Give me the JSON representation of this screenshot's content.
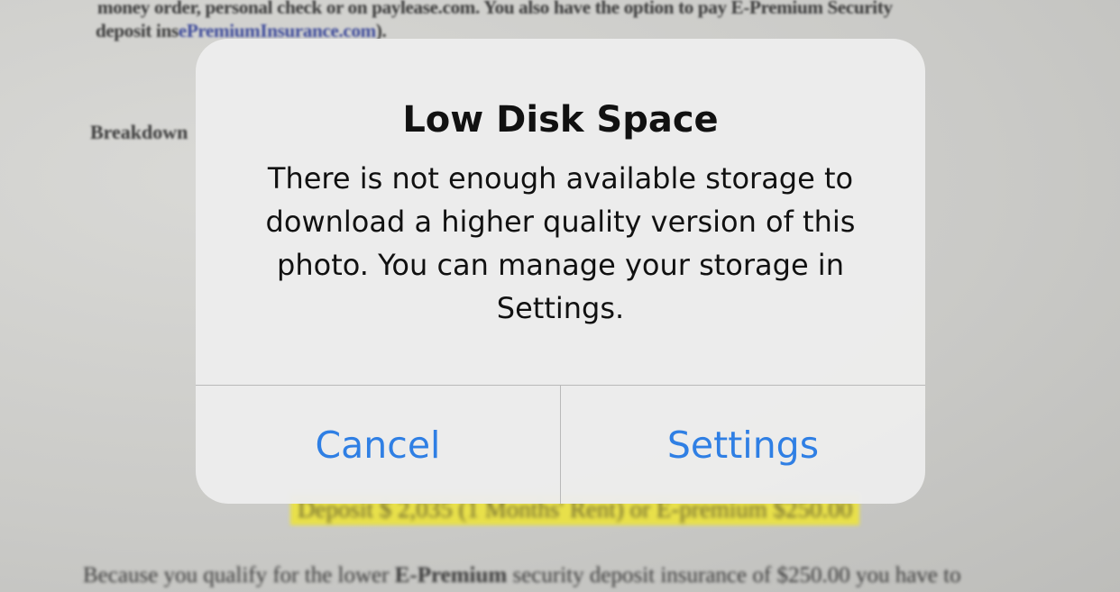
{
  "background": {
    "line1": "money order, personal check or on paylease.com. You also have the option to pay E-Premium Security",
    "line2_prefix": "deposit ins",
    "line2_link": "ePremiumInsurance.com",
    "line2_suffix": ").",
    "heading": "Breakdown",
    "highlight": "Deposit  $ 2,035 (1 Months' Rent) or E-premium $250.00",
    "bottom_prefix": "Because you qualify for the lower ",
    "bottom_bold": "E-Premium",
    "bottom_suffix": " security deposit insurance of $250.00 you have to"
  },
  "alert": {
    "title": "Low Disk Space",
    "message": "There is not enough available storage to download a higher quality version of this photo. You can manage your storage in Settings.",
    "cancel_label": "Cancel",
    "settings_label": "Settings",
    "button_color": "#2f7fe4"
  }
}
